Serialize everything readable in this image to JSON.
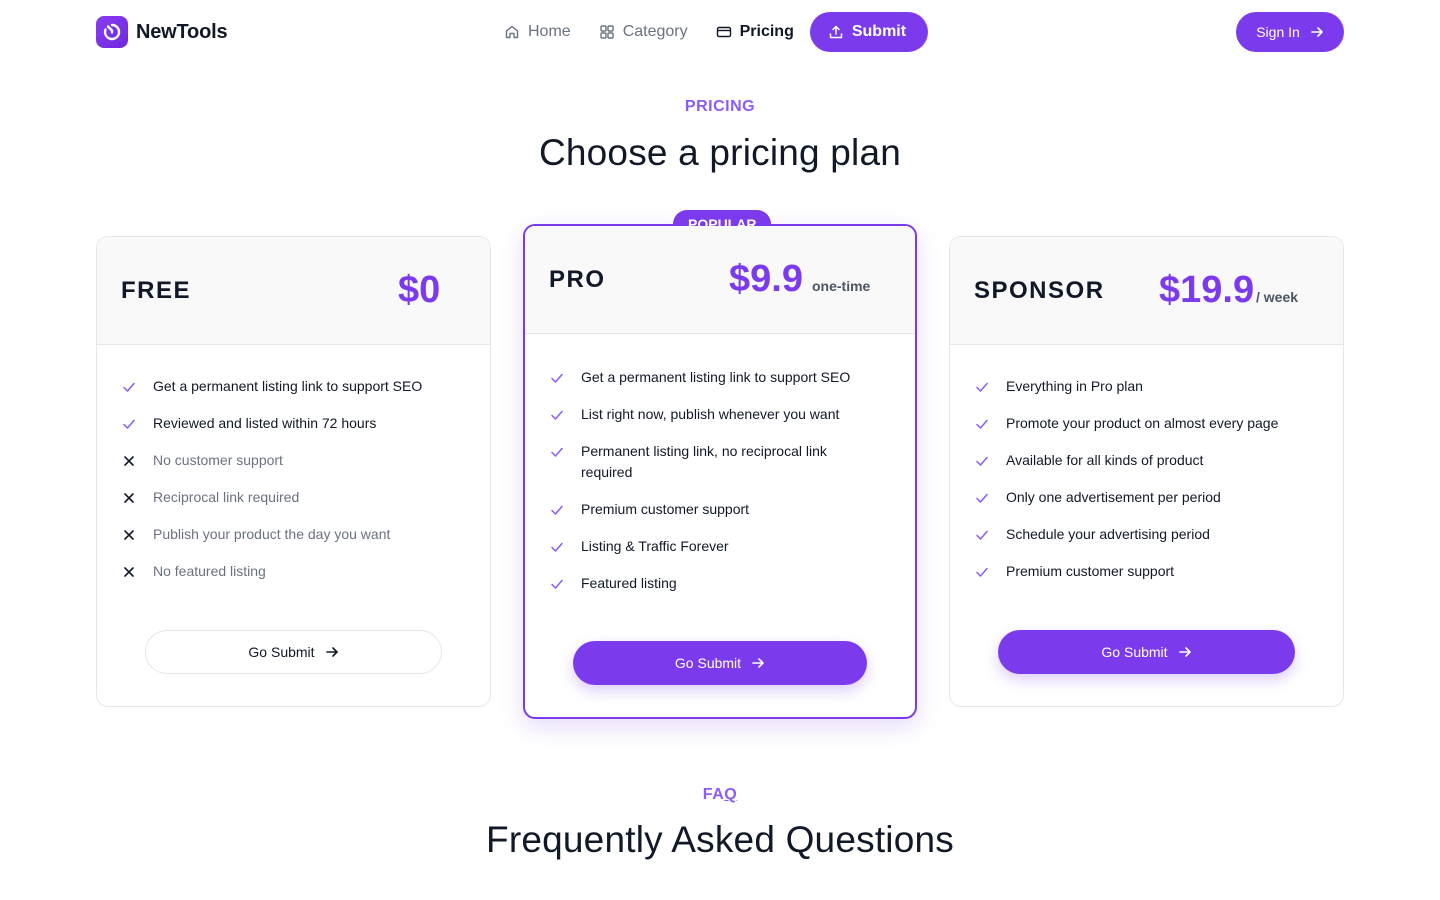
{
  "brand": {
    "name": "NewTools",
    "accent": "#7c3aed"
  },
  "nav": {
    "items": [
      {
        "label": "Home",
        "icon": "home-icon",
        "active": false
      },
      {
        "label": "Category",
        "icon": "grid-icon",
        "active": false
      },
      {
        "label": "Pricing",
        "icon": "credit-card-icon",
        "active": true
      }
    ],
    "submit_label": "Submit",
    "signin_label": "Sign In"
  },
  "pricing": {
    "eyebrow": "PRICING",
    "title": "Choose a pricing plan",
    "plans": [
      {
        "name": "FREE",
        "price": "$0",
        "period": "",
        "button": "Go Submit",
        "features": [
          {
            "text": "Get a permanent listing link to support SEO",
            "included": true
          },
          {
            "text": "Reviewed and listed within 72 hours",
            "included": true
          },
          {
            "text": "No customer support",
            "included": false
          },
          {
            "text": "Reciprocal link required",
            "included": false
          },
          {
            "text": "Publish your product the day you want",
            "included": false
          },
          {
            "text": "No featured listing",
            "included": false
          }
        ]
      },
      {
        "name": "PRO",
        "price": "$9.9",
        "period": "one-time",
        "badge": "POPULAR",
        "button": "Go Submit",
        "features": [
          {
            "text": "Get a permanent listing link to support SEO",
            "included": true
          },
          {
            "text": "List right now, publish whenever you want",
            "included": true
          },
          {
            "text": "Permanent listing link, no reciprocal link required",
            "included": true
          },
          {
            "text": "Premium customer support",
            "included": true
          },
          {
            "text": "Listing & Traffic Forever",
            "included": true
          },
          {
            "text": "Featured listing",
            "included": true
          }
        ]
      },
      {
        "name": "SPONSOR",
        "price": "$19.9",
        "period": "/ week",
        "button": "Go Submit",
        "features": [
          {
            "text": "Everything in Pro plan",
            "included": true
          },
          {
            "text": "Promote your product on almost every page",
            "included": true
          },
          {
            "text": "Available for all kinds of product",
            "included": true
          },
          {
            "text": "Only one advertisement per period",
            "included": true
          },
          {
            "text": "Schedule your advertising period",
            "included": true
          },
          {
            "text": "Premium customer support",
            "included": true
          }
        ]
      }
    ]
  },
  "faq": {
    "eyebrow_a": "FA",
    "eyebrow_b": "Q",
    "title": "Frequently Asked Questions"
  }
}
